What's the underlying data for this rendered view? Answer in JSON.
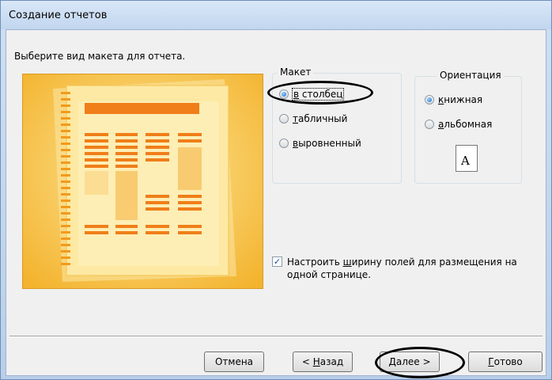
{
  "window": {
    "title": "Создание отчетов"
  },
  "instruction": "Выберите вид макета для отчета.",
  "layout_group": {
    "legend": "Макет",
    "options": [
      {
        "label_underlined": "в",
        "label_rest": " столбец",
        "selected": true
      },
      {
        "label_underlined": "т",
        "label_rest": "абличный",
        "selected": false
      },
      {
        "label_underlined": "в",
        "label_rest": "ыровненный",
        "selected": false
      }
    ]
  },
  "orientation_group": {
    "legend": "Ориентация",
    "options": [
      {
        "label_underlined": "к",
        "label_rest": "нижная",
        "selected": true
      },
      {
        "label_underlined": "а",
        "label_rest": "льбомная",
        "selected": false
      }
    ],
    "icon_letter": "A"
  },
  "fit_checkbox": {
    "checked": true,
    "label_underlined": "ш",
    "label_before": "Настроить ",
    "label_after": "ирину полей для размещения на одной странице."
  },
  "buttons": {
    "cancel": "Отмена",
    "back_prefix": "< ",
    "back_underlined": "Н",
    "back_rest": "азад",
    "next_underlined": "Д",
    "next_rest": "алее >",
    "finish_underlined": "Г",
    "finish_rest": "отово"
  }
}
